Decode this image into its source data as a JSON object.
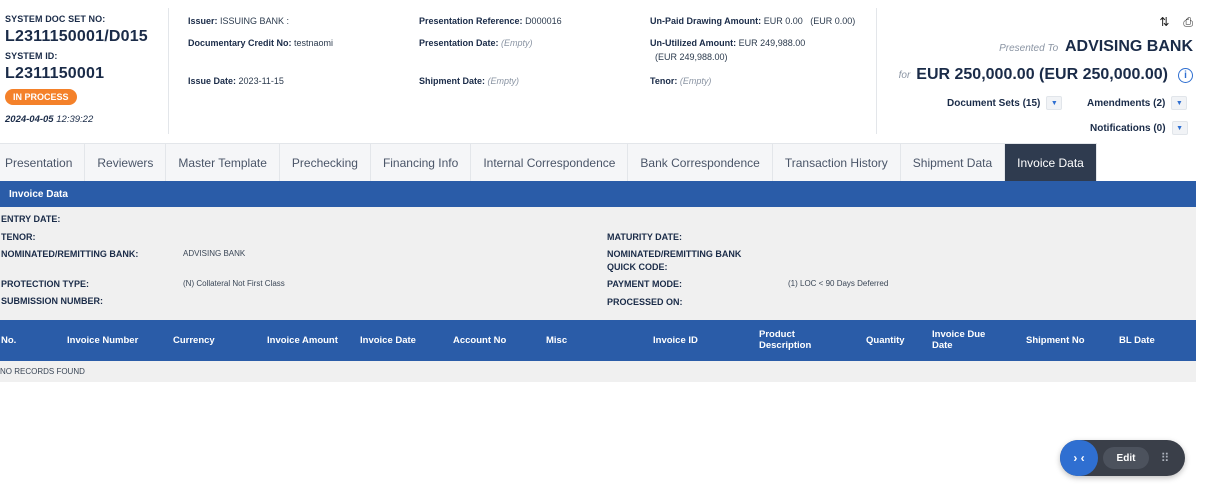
{
  "header": {
    "sys_doc_label": "SYSTEM DOC SET NO:",
    "sys_doc_value": "L2311150001/D015",
    "sys_id_label": "SYSTEM ID:",
    "sys_id_value": "L2311150001",
    "status": "IN PROCESS",
    "date": "2024-04-05",
    "time": "12:39:22",
    "issuer_label": "Issuer:",
    "issuer_value": "ISSUING BANK :",
    "credit_label": "Documentary Credit No:",
    "credit_value": "testnaomi",
    "issue_date_label": "Issue Date:",
    "issue_date_value": "2023-11-15",
    "pres_ref_label": "Presentation Reference:",
    "pres_ref_value": "D000016",
    "pres_date_label": "Presentation Date:",
    "pres_date_value": "(Empty)",
    "ship_date_label": "Shipment Date:",
    "ship_date_value": "(Empty)",
    "unpaid_label": "Un-Paid Drawing Amount:",
    "unpaid_value": "EUR 0.00   (EUR 0.00)",
    "unutil_label": "Un-Utilized Amount:",
    "unutil_value": "EUR 249,988.00",
    "unutil_value2": "(EUR 249,988.00)",
    "tenor_label": "Tenor:",
    "tenor_value": "(Empty)",
    "presented_to_label": "Presented To",
    "presented_to_value": "ADVISING BANK",
    "for_label": "for",
    "amount": "EUR 250,000.00 (EUR 250,000.00)",
    "doc_sets": "Document Sets (15)",
    "amendments": "Amendments (2)",
    "notifications": "Notifications (0)"
  },
  "tabs": [
    {
      "label": "Presentation"
    },
    {
      "label": "Reviewers"
    },
    {
      "label": "Master Template"
    },
    {
      "label": "Prechecking"
    },
    {
      "label": "Financing Info"
    },
    {
      "label": "Internal Correspondence"
    },
    {
      "label": "Bank Correspondence"
    },
    {
      "label": "Transaction History"
    },
    {
      "label": "Shipment Data"
    },
    {
      "label": "Invoice Data"
    }
  ],
  "section": {
    "title": "Invoice Data",
    "entry_date_label": "ENTRY DATE:",
    "tenor_label": "TENOR:",
    "nominated_label": "NOMINATED/REMITTING BANK:",
    "nominated_value": "ADVISING BANK",
    "protection_label": "PROTECTION TYPE:",
    "protection_value": "(N) Collateral Not First Class",
    "submission_label": "SUBMISSION NUMBER:",
    "maturity_label": "MATURITY DATE:",
    "quick_code_label_1": "NOMINATED/REMITTING BANK",
    "quick_code_label_2": "QUICK CODE:",
    "payment_label": "PAYMENT MODE:",
    "payment_value": "(1) LOC < 90 Days Deferred",
    "processed_label": "PROCESSED ON:"
  },
  "table": {
    "columns": [
      "No.",
      "Invoice Number",
      "Currency",
      "Invoice Amount",
      "Invoice Date",
      "Account No",
      "Misc",
      "Invoice ID",
      "Product Description",
      "Quantity",
      "Invoice Due Date",
      "Shipment No",
      "BL Date"
    ],
    "empty_text": "NO RECORDS FOUND"
  },
  "toolbar": {
    "toggle_glyph": "› ‹",
    "edit_label": "Edit"
  },
  "colors": {
    "accent": "#2a5ca8",
    "status": "#f4812a",
    "active_tab": "#2f3b4f"
  }
}
